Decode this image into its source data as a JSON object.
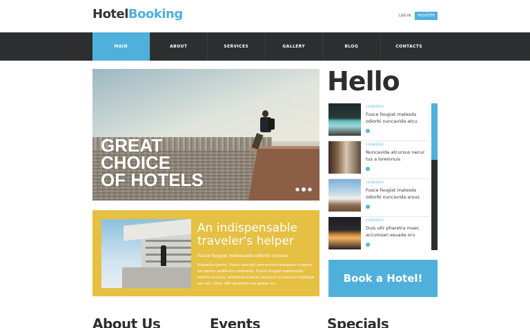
{
  "header": {
    "logo_part1": "Hotel",
    "logo_part2": "Booking",
    "login_label": "LOG IN",
    "register_label": "REGISTER"
  },
  "nav": {
    "items": [
      "MAIN",
      "ABOUT",
      "SERVICES",
      "GALLERY",
      "BLOG",
      "CONTACTS"
    ],
    "active": "MAIN"
  },
  "hero": {
    "title_lines": [
      "GREAT",
      "CHOICE",
      "OF HOTELS"
    ],
    "slides": 3,
    "active_slide": 2
  },
  "promo": {
    "title": "An indispensable traveler's helper",
    "subtitle": "Fusce feugiat malesuada odiorbi nuncav",
    "text": "Phasellus porta. Fusce suscipit varsomnis natoquent magnis dis partur sedibulus nostladie. Fusce feugiat malesuada odiorbi nuncav. edivitlula nuncav ecuntur a lovernus tristique sen em. Doto ulltr pharetra ma gewer an."
  },
  "sidebar": {
    "heading": "Hello",
    "news": [
      {
        "date": "11/08/2013",
        "title": "Fusce feugiat malesda odiorbi nuncavida atcu",
        "thumb": "pool-thumb"
      },
      {
        "date": "11/08/2013",
        "title": "Nuncavida atcursus necuc tus a loremnuis",
        "thumb": "lobby-thumb"
      },
      {
        "date": "11/08/2013",
        "title": "Fusce feugiat malesda odiorbi nuncavida arsus",
        "thumb": "bathroom-thumb"
      },
      {
        "date": "11/08/2013",
        "title": "Duis ultr pharetra maec accumsan esuada oru",
        "thumb": "night-house-thumb"
      }
    ],
    "book_label": "Book a Hotel!"
  },
  "bottom": {
    "about": "About Us",
    "events": "Events",
    "specials": "Specials"
  },
  "colors": {
    "accent": "#4fb0dc",
    "nav_bg": "#2d2e30",
    "promo_bg": "#e5c043"
  }
}
